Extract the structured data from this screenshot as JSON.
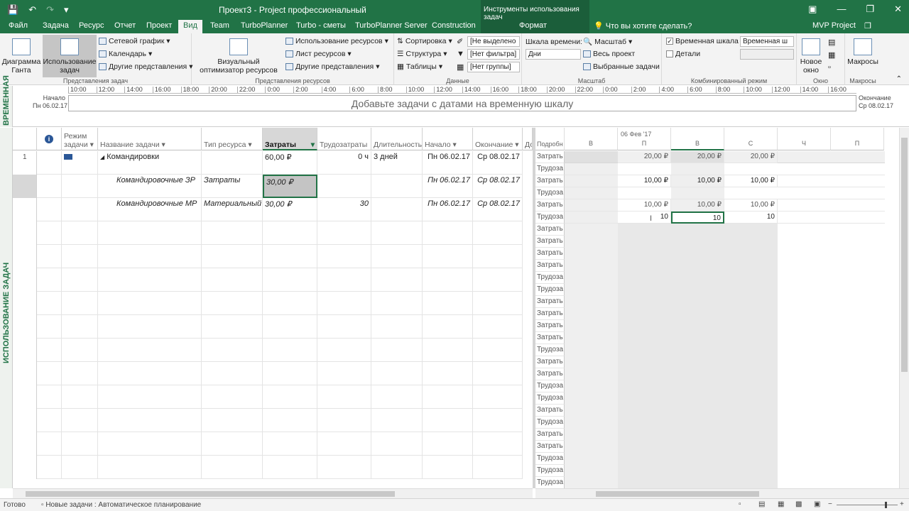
{
  "title_bar": {
    "title": "Проект3 - Project профессиональный",
    "context_tools": "Инструменты использования задач",
    "qat": [
      "save-icon",
      "undo-icon",
      "redo-icon",
      "customize-qat-icon"
    ]
  },
  "menu": {
    "tabs": [
      "Файл",
      "Задача",
      "Ресурс",
      "Отчет",
      "Проект",
      "Вид",
      "Team",
      "TurboPlanner",
      "Turbo - сметы",
      "TurboPlanner Server",
      "Construction"
    ],
    "active": "Вид",
    "context_tab": "Формат",
    "tell_me": "Что вы хотите сделать?",
    "account": "MVP Project"
  },
  "ribbon": {
    "task_views": {
      "label": "Представления задач",
      "gantt": "Диаграмма Ганта",
      "task_usage": "Использование задач",
      "network": "Сетевой график",
      "calendar": "Календарь",
      "other": "Другие представления"
    },
    "resource_views": {
      "label": "Представления ресурсов",
      "visual_optimizer": "Визуальный оптимизатор ресурсов",
      "resource_usage": "Использование ресурсов",
      "resource_sheet": "Лист ресурсов",
      "other": "Другие представления"
    },
    "data": {
      "label": "Данные",
      "sort": "Сортировка",
      "outline": "Структура",
      "tables": "Таблицы",
      "highlight": "[Не выделено",
      "filter": "[Нет фильтра]",
      "group": "[Нет группы]"
    },
    "zoom": {
      "label": "Масштаб",
      "timescale_label": "Шкала времени:",
      "timescale_value": "Дни",
      "zoom": "Масштаб",
      "entire_project": "Весь проект",
      "selected_tasks": "Выбранные задачи"
    },
    "split_view": {
      "label": "Комбинированный режим",
      "timeline": "Временная шкала",
      "timeline_value": "Временная ш",
      "timeline_checked": true,
      "details": "Детали",
      "details_checked": false
    },
    "window": {
      "label": "Окно",
      "new_window": "Новое окно"
    },
    "macros": {
      "label": "Макросы",
      "macros": "Макросы"
    }
  },
  "timeline": {
    "side_label": "ВРЕМЕННАЯ",
    "start_label": "Начало",
    "start_date": "Пн 06.02.17",
    "end_label": "Окончание",
    "end_date": "Ср 08.02.17",
    "placeholder": "Добавьте задачи с датами на временную шкалу",
    "ticks": [
      "10:00",
      "12:00",
      "14:00",
      "16:00",
      "18:00",
      "20:00",
      "22:00",
      "0:00",
      "2:00",
      "4:00",
      "6:00",
      "8:00",
      "10:00",
      "12:00",
      "14:00",
      "16:00",
      "18:00",
      "20:00",
      "22:00",
      "0:00",
      "2:00",
      "4:00",
      "6:00",
      "8:00",
      "10:00",
      "12:00",
      "14:00",
      "16:00"
    ]
  },
  "view_label": "ИСПОЛЬЗОВАНИЕ ЗАДАЧ",
  "table": {
    "headers": {
      "mode": "Режим задачи",
      "name": "Название задачи",
      "resource_type": "Тип ресурса",
      "cost": "Затраты",
      "work": "Трудозатраты",
      "duration": "Длительность",
      "start": "Начало",
      "finish": "Окончание",
      "extra": "Доб"
    },
    "rows": [
      {
        "id": "1",
        "name": "Командировки",
        "resource_type": "",
        "cost": "60,00 ₽",
        "work": "0 ч",
        "duration": "3 дней",
        "start": "Пн 06.02.17",
        "finish": "Ср 08.02.17"
      },
      {
        "id": "",
        "name": "Командировочные ЗР",
        "resource_type": "Затраты",
        "cost": "30,00 ₽",
        "work": "",
        "duration": "",
        "start": "Пн 06.02.17",
        "finish": "Ср 08.02.17"
      },
      {
        "id": "",
        "name": "Командировочные МР",
        "resource_type": "Материальный",
        "cost": "30,00 ₽",
        "work": "30",
        "duration": "",
        "start": "Пн 06.02.17",
        "finish": "Ср 08.02.17"
      }
    ]
  },
  "usage": {
    "detail_header": "Подробн",
    "week_label": "06 Фев '17",
    "days": [
      "В",
      "П",
      "В",
      "С",
      "Ч",
      "П"
    ],
    "details": [
      "Затрать",
      "Трудоза",
      "Затрать",
      "Трудоза",
      "Затрать",
      "Трудоза",
      "Затрать",
      "Затрать",
      "Затрать",
      "Затрать",
      "Трудоза",
      "Трудоза",
      "Затрать",
      "Затрать",
      "Затрать",
      "Затрать",
      "Трудоза",
      "Затрать",
      "Затрать",
      "Трудоза",
      "Трудоза",
      "Затрать",
      "Трудоза",
      "Затрать",
      "Затрать",
      "Трудоза",
      "Трудоза",
      "Трудоза"
    ],
    "values": {
      "r0": [
        "20,00 ₽",
        "20,00 ₽",
        "20,00 ₽"
      ],
      "r2": [
        "10,00 ₽",
        "10,00 ₽",
        "10,00 ₽"
      ],
      "r4": [
        "10,00 ₽",
        "10,00 ₽",
        "10,00 ₽"
      ],
      "r5": [
        "10",
        "10",
        "10"
      ]
    }
  },
  "status": {
    "ready": "Готово",
    "new_tasks": "Новые задачи : Автоматическое планирование"
  }
}
